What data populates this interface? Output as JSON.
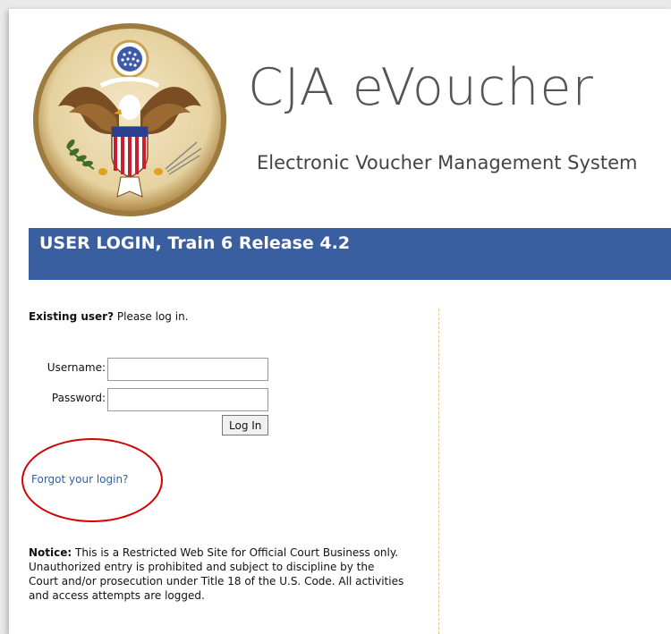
{
  "header": {
    "app_title": "CJA eVoucher",
    "app_subtitle": "Electronic Voucher Management System"
  },
  "banner": {
    "title": "USER LOGIN, Train 6 Release 4.2"
  },
  "login": {
    "existing_bold": "Existing user?",
    "existing_rest": " Please log in.",
    "username_label": "Username:",
    "username_value": "",
    "password_label": "Password:",
    "password_value": "",
    "login_button": "Log In",
    "forgot_link": "Forgot your login?"
  },
  "notice": {
    "bold": "Notice:",
    "text": " This is a Restricted Web Site for Official Court Business only. Unauthorized entry is prohibited and subject to discipline by the Court and/or prosecution under Title 18 of the U.S. Code. All activities and access attempts are logged."
  },
  "colors": {
    "banner": "#3a5fa1",
    "link": "#2a60b8",
    "highlight_circle": "#d40000",
    "divider": "#e8c48a"
  }
}
